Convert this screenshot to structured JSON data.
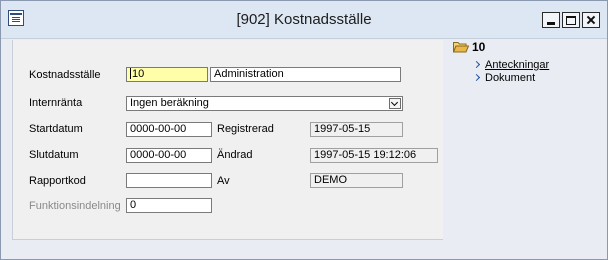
{
  "window": {
    "title": "[902]  Kostnadsställe"
  },
  "form": {
    "kostnadsstalle": {
      "label": "Kostnadsställe",
      "code": "10",
      "name": "Administration"
    },
    "internranta": {
      "label": "Internränta",
      "value": "Ingen beräkning"
    },
    "startdatum": {
      "label": "Startdatum",
      "value": "0000-00-00"
    },
    "slutdatum": {
      "label": "Slutdatum",
      "value": "0000-00-00"
    },
    "rapportkod": {
      "label": "Rapportkod",
      "value": ""
    },
    "funktionsindelning": {
      "label": "Funktionsindelning",
      "value": "0"
    },
    "registrerad": {
      "label": "Registrerad",
      "value": "1997-05-15"
    },
    "andrad": {
      "label": "Ändrad",
      "value": "1997-05-15 19:12:06"
    },
    "av": {
      "label": "Av",
      "value": "DEMO"
    }
  },
  "side": {
    "folder_id": "10",
    "links": [
      {
        "label": "Anteckningar"
      },
      {
        "label": "Dokument"
      }
    ]
  },
  "colors": {
    "titlebar": "#dde7f3",
    "panel": "#f0f0f0",
    "highlight_field": "#ffffaa",
    "link": "#1f4f9e",
    "folder": "#e8b84a"
  },
  "icons": {
    "window_menu": "window-menu-icon",
    "minimize": "minimize-icon",
    "maximize": "maximize-icon",
    "close": "close-icon",
    "folder": "open-folder-icon",
    "link_arrow": "chevron-right-icon",
    "dropdown": "chevron-down-icon"
  }
}
